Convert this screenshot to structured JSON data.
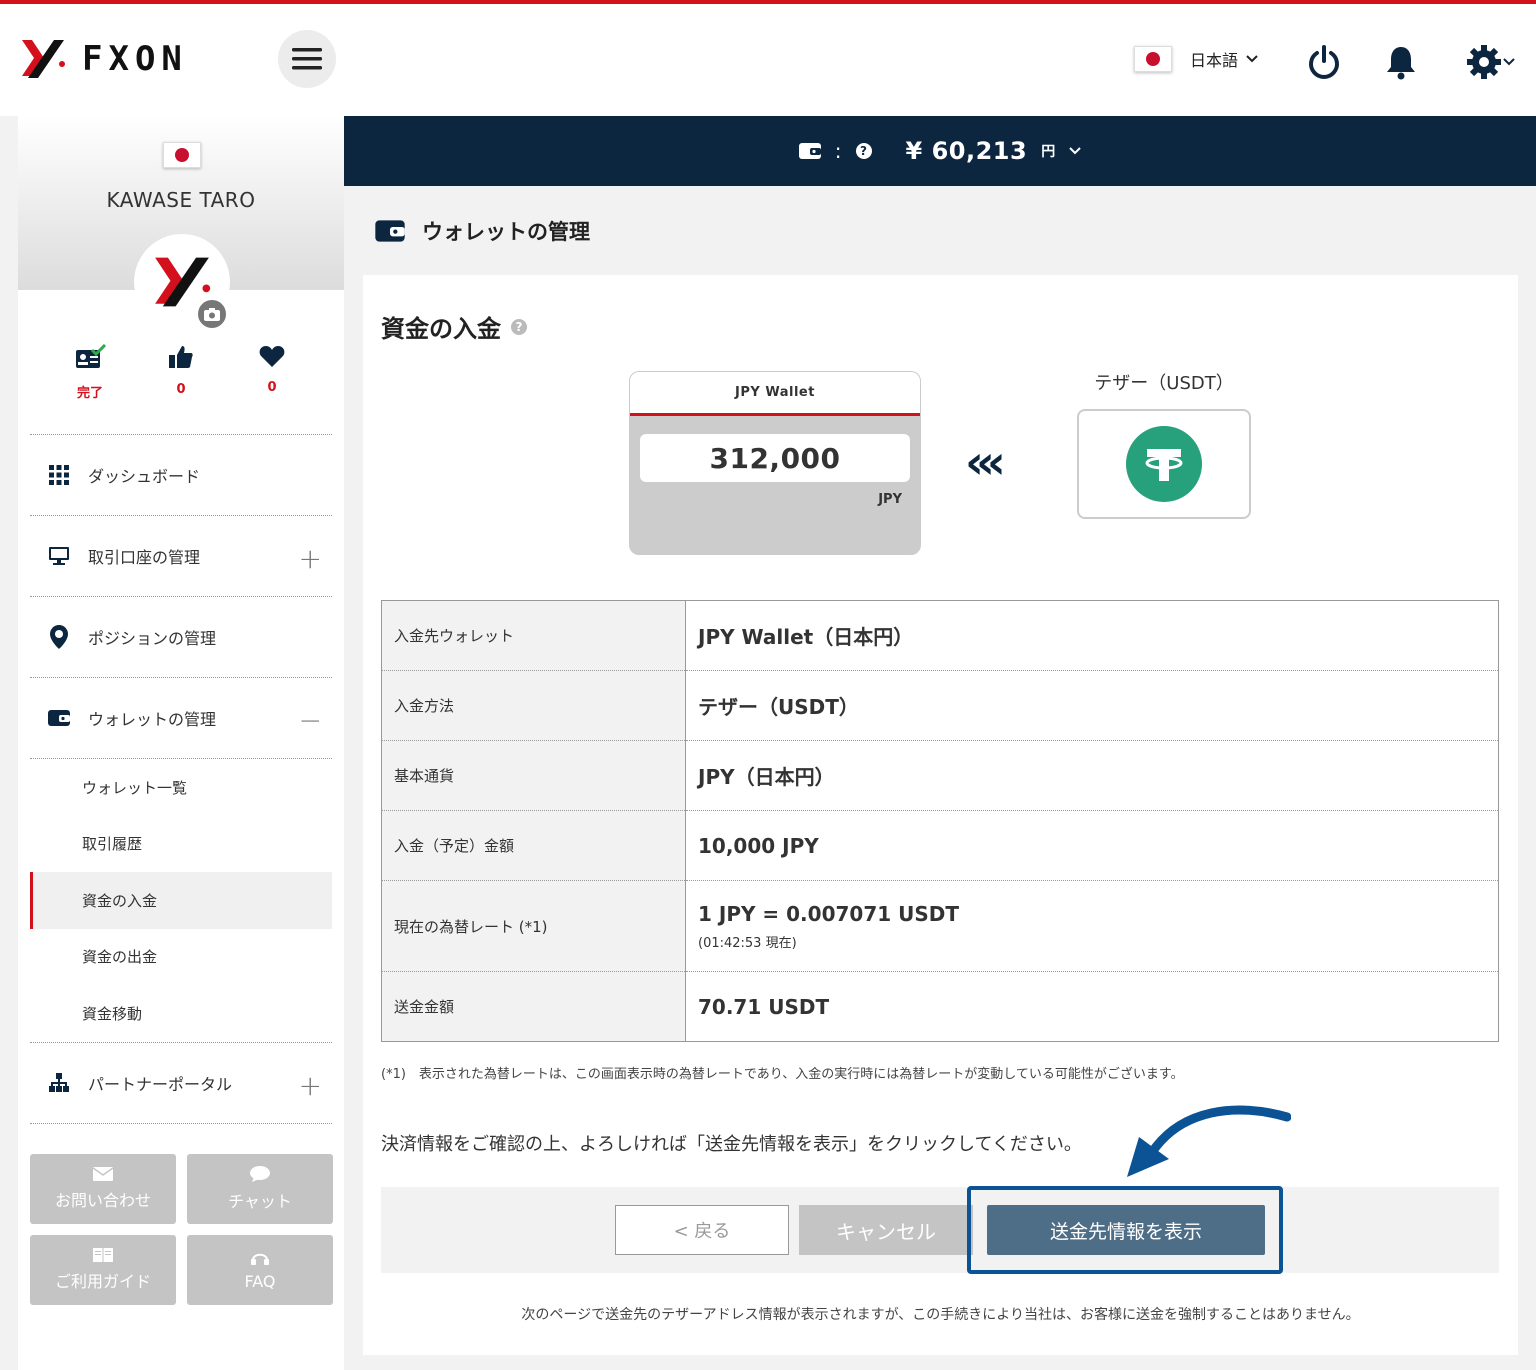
{
  "header": {
    "logo_text": "FXON",
    "language": "日本語"
  },
  "balance": {
    "symbol": "¥",
    "amount": "60,213",
    "unit": "円"
  },
  "profile": {
    "name": "KAWASE TARO",
    "stats": [
      {
        "icon": "id-card-check-icon",
        "value": "完了"
      },
      {
        "icon": "thumbs-up-icon",
        "value": "0"
      },
      {
        "icon": "heart-icon",
        "value": "0"
      }
    ]
  },
  "nav": {
    "dashboard": "ダッシュボード",
    "accounts": "取引口座の管理",
    "positions": "ポジションの管理",
    "wallet": "ウォレットの管理",
    "wallet_sub": [
      "ウォレット一覧",
      "取引履歴",
      "資金の入金",
      "資金の出金",
      "資金移動"
    ],
    "partner": "パートナーポータル"
  },
  "help": {
    "contact": "お問い合わせ",
    "chat": "チャット",
    "guide": "ご利用ガイド",
    "faq": "FAQ"
  },
  "page": {
    "title": "ウォレットの管理",
    "section_title": "資金の入金"
  },
  "wallet_card": {
    "name": "JPY Wallet",
    "amount": "312,000",
    "currency": "JPY"
  },
  "method": {
    "label": "テザー（USDT）"
  },
  "details": {
    "rows": [
      {
        "key": "入金先ウォレット",
        "value": "JPY Wallet（日本円）"
      },
      {
        "key": "入金方法",
        "value": "テザー（USDT）"
      },
      {
        "key": "基本通貨",
        "value": "JPY（日本円）"
      },
      {
        "key": "入金（予定）金額",
        "value": "10,000 JPY"
      },
      {
        "key": "現在の為替レート (*1)",
        "value": "1 JPY = 0.007071 USDT",
        "sub": "(01:42:53 現在)"
      },
      {
        "key": "送金金額",
        "value": "70.71 USDT"
      }
    ]
  },
  "note": "(*1)　表示された為替レートは、この画面表示時の為替レートであり、入金の実行時には為替レートが変動している可能性がございます。",
  "confirm_text": "決済情報をご確認の上、よろしければ「送金先情報を表示」をクリックしてください。",
  "buttons": {
    "back": "< 戻る",
    "cancel": "キャンセル",
    "show": "送金先情報を表示"
  },
  "footer_note": "次のページで送金先のテザーアドレス情報が表示されますが、この手続きにより当社は、お客様に送金を強制することはありません。"
}
